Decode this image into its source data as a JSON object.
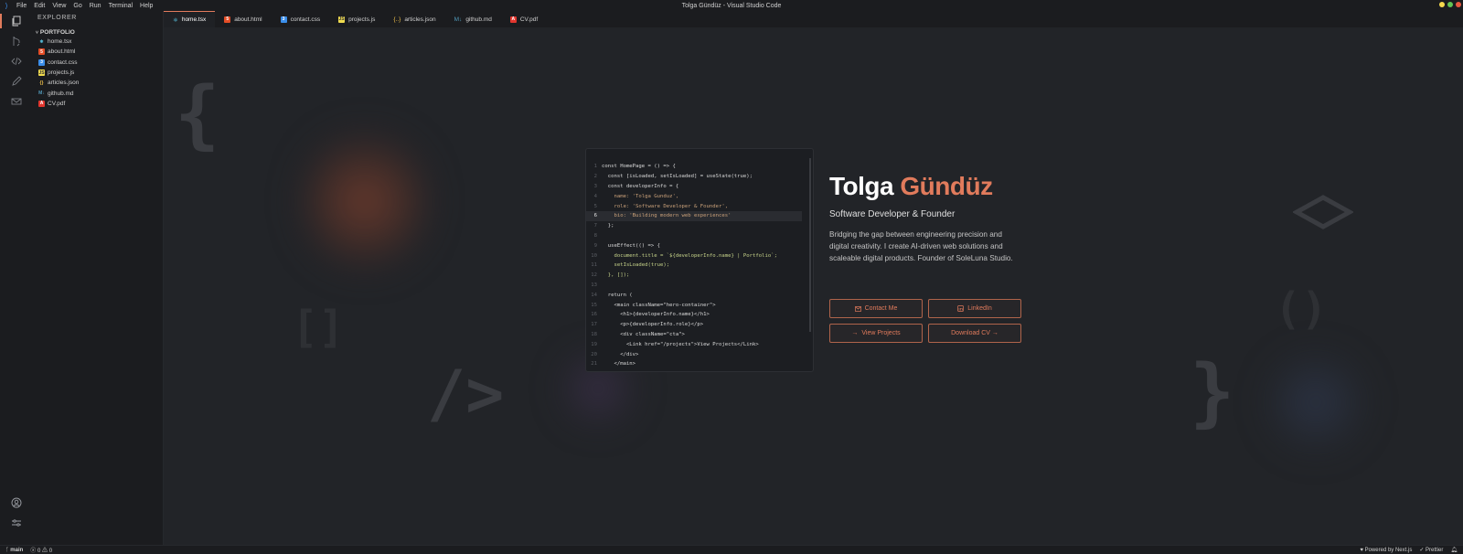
{
  "window": {
    "title": "Tolga Gündüz - Visual Studio Code",
    "menu": [
      "File",
      "Edit",
      "View",
      "Go",
      "Run",
      "Terminal",
      "Help"
    ],
    "controls": [
      {
        "name": "minimize",
        "color": "#f5d94e"
      },
      {
        "name": "maximize",
        "color": "#62c554"
      },
      {
        "name": "close",
        "color": "#e8573f"
      }
    ]
  },
  "activity_bar": {
    "items": [
      "files-icon",
      "git-icon",
      "code-icon",
      "pencil-icon",
      "mail-icon"
    ],
    "bottom": [
      "account-icon",
      "settings-icon"
    ],
    "accent": "#e17b5c"
  },
  "explorer": {
    "title": "EXPLORER",
    "folder": "PORTFOLIO",
    "files": [
      {
        "name": "home.tsx",
        "icon": "react-icon",
        "color": "#61dafb"
      },
      {
        "name": "about.html",
        "icon": "html-icon",
        "color": "#e44d26"
      },
      {
        "name": "contact.css",
        "icon": "css-icon",
        "color": "#3b8eea"
      },
      {
        "name": "projects.js",
        "icon": "js-icon",
        "color": "#f0db4f"
      },
      {
        "name": "articles.json",
        "icon": "json-icon",
        "color": "#f0c14b"
      },
      {
        "name": "github.md",
        "icon": "markdown-icon",
        "color": "#519aba"
      },
      {
        "name": "CV.pdf",
        "icon": "pdf-icon",
        "color": "#e2362e"
      }
    ]
  },
  "tabs": [
    {
      "label": "home.tsx",
      "icon": "react-icon",
      "active": true
    },
    {
      "label": "about.html",
      "icon": "html-icon"
    },
    {
      "label": "contact.css",
      "icon": "css-icon"
    },
    {
      "label": "projects.js",
      "icon": "js-icon"
    },
    {
      "label": "articles.json",
      "icon": "json-icon"
    },
    {
      "label": "github.md",
      "icon": "markdown-icon"
    },
    {
      "label": "CV.pdf",
      "icon": "pdf-icon"
    }
  ],
  "code": {
    "active_line": 6,
    "lines": [
      "const HomePage = () => {",
      "  const [isLoaded, setIsLoaded] = useState(true);",
      "  const developerInfo = {",
      "    name: 'Tolga Gunduz',",
      "    role: 'Software Developer & Founder',",
      "    bio: 'Building modern web experiences'",
      "  };",
      "",
      "  useEffect(() => {",
      "    document.title = `${developerInfo.name} | Portfolio`;",
      "    setIsLoaded(true);",
      "  }, []);",
      "",
      "  return (",
      "    <main className=\"hero-container\">",
      "      <h1>{developerInfo.name}</h1>",
      "      <p>{developerInfo.role}</p>",
      "      <div className=\"cta\">",
      "        <Link href=\"/projects\">View Projects</Link>",
      "      </div>",
      "    </main>",
      "  );"
    ]
  },
  "hero": {
    "first_name": "Tolga",
    "last_name": "Gündüz",
    "role": "Software Developer & Founder",
    "bio": "Bridging the gap between engineering precision and digital creativity. I create AI-driven web solutions and scaleable digital products. Founder of SoleLuna Studio.",
    "accent": "#e17b5c",
    "buttons": {
      "contact": "Contact Me",
      "linkedin": "LinkedIn",
      "projects": "View Projects",
      "cv": "Download CV →"
    }
  },
  "statusbar": {
    "branch": "main",
    "errors": "0",
    "warnings": "0",
    "powered": "Powered by Next.js",
    "formatter": "Prettier"
  }
}
